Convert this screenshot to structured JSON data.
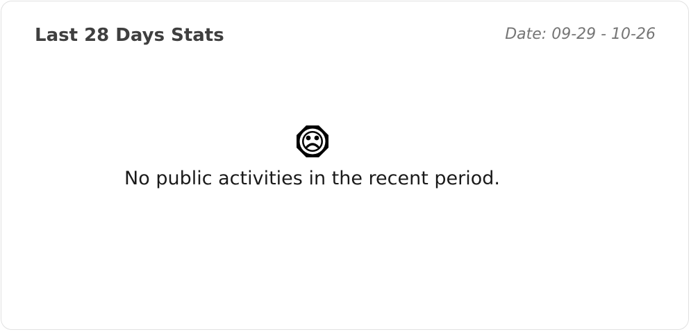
{
  "card": {
    "title": "Last 28 Days Stats",
    "date_range": "Date: 09-29 - 10-26"
  },
  "empty_state": {
    "icon": "sad-face-icon",
    "message": "No public activities in the recent period."
  }
}
